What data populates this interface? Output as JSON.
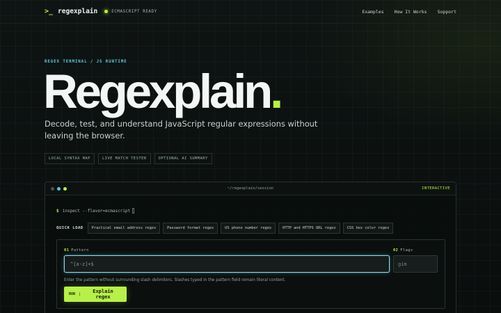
{
  "colors": {
    "accent": "#b7f04a",
    "cyan": "#5ec7d9",
    "background": "#0b0f0e"
  },
  "nav": {
    "prompt": ">_",
    "brand": "regexplain",
    "status": "ECMASCRIPT READY",
    "links": [
      "Examples",
      "How It Works",
      "Support"
    ]
  },
  "hero": {
    "eyebrow": "REGEX TERMINAL / JS RUNTIME",
    "title": "Regexplain",
    "title_dot": ".",
    "subtitle": "Decode, test, and understand JavaScript regular expressions without leaving the browser.",
    "features": [
      "LOCAL SYNTAX MAP",
      "LIVE MATCH TESTER",
      "OPTIONAL AI SUMMARY"
    ]
  },
  "terminal": {
    "path": "~/regexplain/session",
    "mode": "INTERACTIVE",
    "command_prompt": "$",
    "command": "inspect --flavor=ecmascript",
    "quick_load_label": "QUICK LOAD",
    "quick_load": [
      "Practical email address regex",
      "Password format regex",
      "US phone number regex",
      "HTTP and HTTPS URL regex",
      "CSS hex color regex"
    ],
    "pattern": {
      "number": "01",
      "label": "Pattern",
      "placeholder": "^[a-z]+$",
      "value": ""
    },
    "flags": {
      "number": "02",
      "label": "Flags",
      "placeholder": "gim",
      "value": ""
    },
    "helper": "Enter the pattern without surrounding slash delimiters. Slashes typed in the pattern field remain literal content.",
    "run_tag": "RUN",
    "run_label": "Explain regex"
  },
  "icons": {
    "prompt": "terminal-prompt-icon",
    "status": "status-dot-icon",
    "window_controls": [
      "window-dot-gray",
      "window-dot-cyan",
      "window-dot-green"
    ],
    "cursor": "cursor-block-icon"
  }
}
